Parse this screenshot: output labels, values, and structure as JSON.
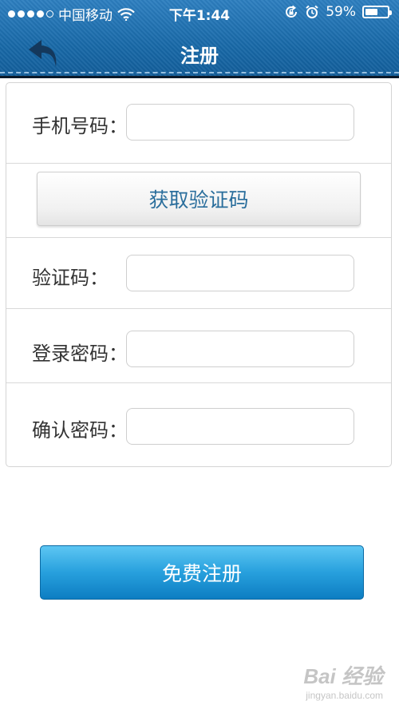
{
  "status_bar": {
    "carrier": "中国移动",
    "time": "下午1:44",
    "battery_text": "59%",
    "battery_level": 0.59,
    "signal_dots": 5,
    "signal_filled": 4,
    "icons": [
      "signal-icon",
      "wifi-icon",
      "rotation-lock-icon",
      "alarm-icon",
      "battery-icon"
    ]
  },
  "nav": {
    "title": "注册",
    "back_icon": "back-arrow-icon"
  },
  "form": {
    "phone_label": "手机号码：",
    "code_button_label": "获取验证码",
    "code_label": "验证码：",
    "password_label": "登录密码：",
    "confirm_label": "确认密码：",
    "phone_value": "",
    "code_value": "",
    "password_value": "",
    "confirm_value": ""
  },
  "register_button_label": "免费注册",
  "watermark": {
    "brand": "Bai 经验",
    "url": "jingyan.baidu.com"
  },
  "colors": {
    "header": "#1869a8",
    "link_text": "#2a6e9c",
    "primary_button": "#27a0dd"
  }
}
